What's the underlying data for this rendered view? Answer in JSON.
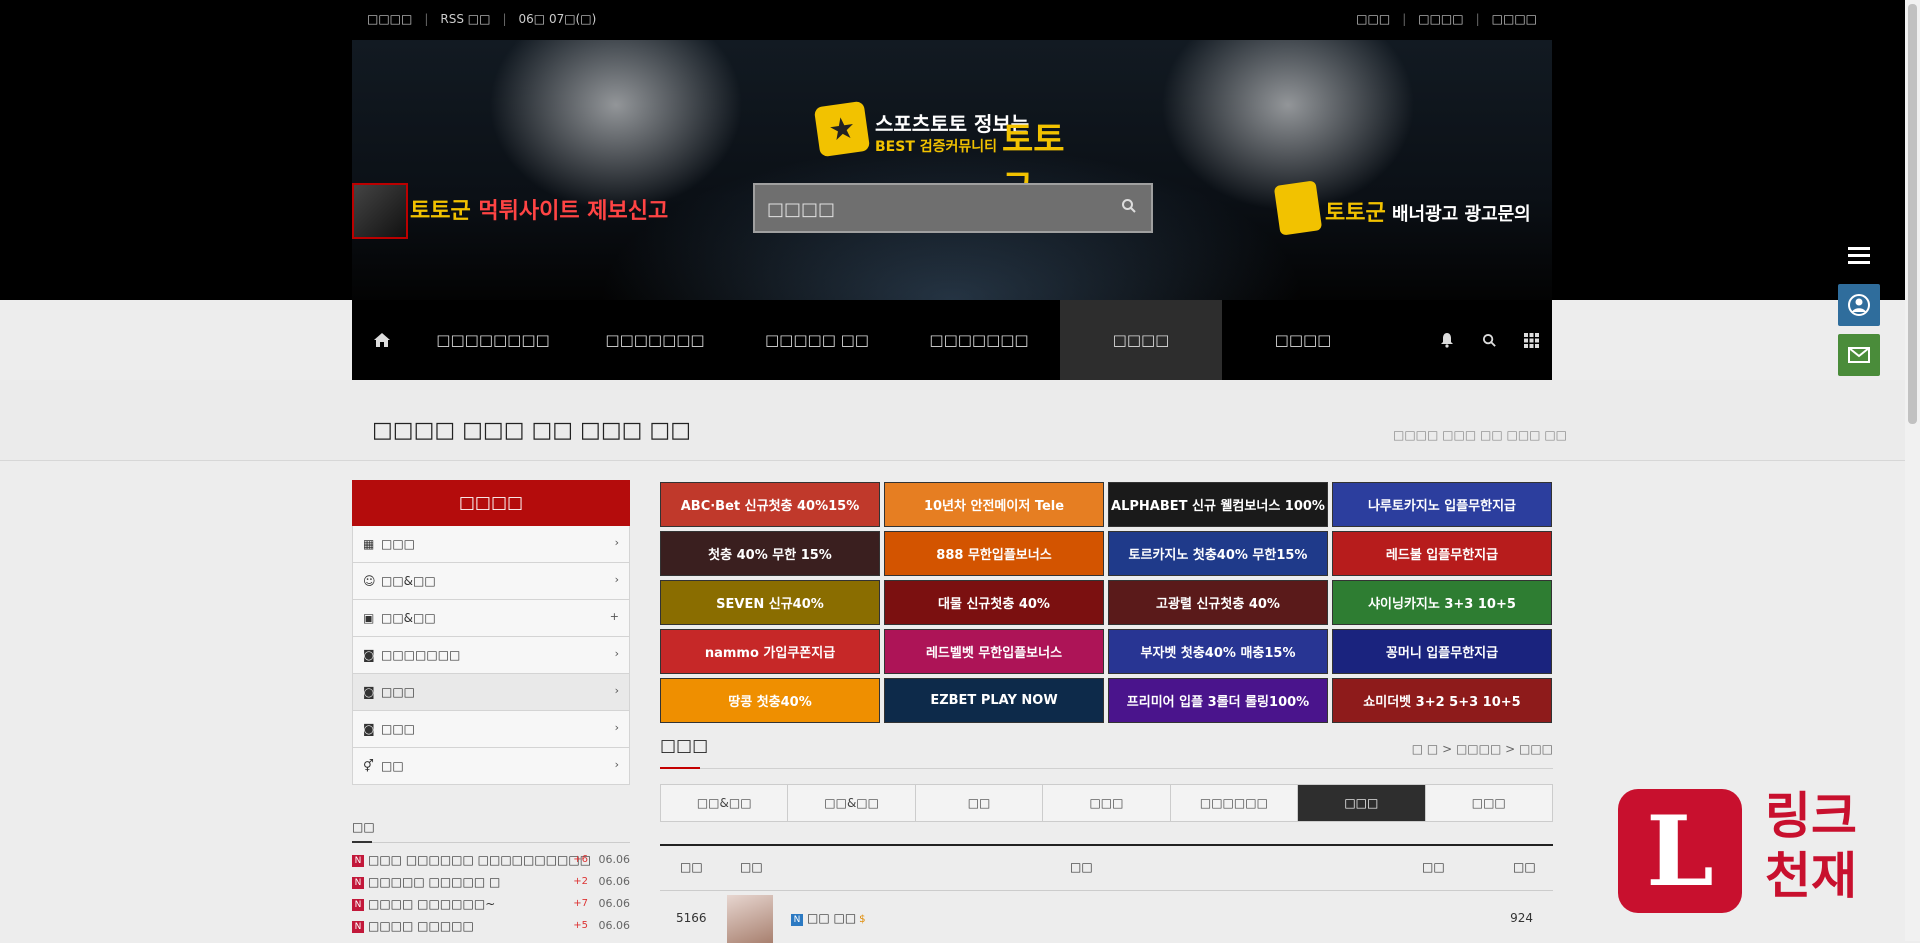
{
  "topbar": {
    "left": [
      "□□□□",
      "RSS □□",
      "06□ 07□(□)"
    ],
    "right": [
      "□□□",
      "□□□□",
      "□□□□"
    ]
  },
  "logo": {
    "line1": "스포츠토토 정보는",
    "line2": "BEST 검증커뮤니티",
    "brand": "토토군"
  },
  "search": {
    "placeholder": "□□□□"
  },
  "banner_left": {
    "text_yellow": "토토군",
    "text_red": " 먹튀사이트 제보신고"
  },
  "banner_right": {
    "text_yellow": "토토군",
    "text_white": " 배너광고 광고문의"
  },
  "nav": {
    "items": [
      "□□□□□□□□",
      "□□□□□□□",
      "□□□□□ □□",
      "□□□□□□□",
      "□□□□",
      "□□□□"
    ],
    "active_index": 4
  },
  "page": {
    "title": "□□□□ □□□ □□ □□□ □□",
    "breadcrumb": "□□□□ □□□ □□ □□□ □□"
  },
  "sidebar": {
    "head": "□□□□",
    "items": [
      {
        "icon": "calendar-icon",
        "label": "□□□",
        "arrow": "›"
      },
      {
        "icon": "smile-icon",
        "label": "□□&□□",
        "arrow": "›"
      },
      {
        "icon": "image-icon",
        "label": "□□&□□",
        "arrow": "+"
      },
      {
        "icon": "camera-icon",
        "label": "□□□□□□□",
        "arrow": "›"
      },
      {
        "icon": "camera-icon",
        "label": "□□□",
        "arrow": "›"
      },
      {
        "icon": "camera-icon",
        "label": "□□□",
        "arrow": "›"
      },
      {
        "icon": "gender-icon",
        "label": "□□",
        "arrow": "›"
      }
    ],
    "active_index": 4
  },
  "recent": {
    "title": "□□",
    "items": [
      {
        "badge": "N",
        "title": "□□□ □□□□□□ □□□□□□□□□□",
        "count": "+6",
        "date": "06.06"
      },
      {
        "badge": "N",
        "title": "□□□□□ □□□□□ □",
        "count": "+2",
        "date": "06.06"
      },
      {
        "badge": "N",
        "title": "□□□□ □□□□□□~",
        "count": "+7",
        "date": "06.06"
      },
      {
        "badge": "N",
        "title": "□□□□ □□□□□",
        "count": "+5",
        "date": "06.06"
      }
    ]
  },
  "banners": [
    {
      "text": "ABC·Bet 신규첫충 40%15%",
      "bg": "#c0392b"
    },
    {
      "text": "10년차 안전메이저 Tele",
      "bg": "#e67e22"
    },
    {
      "text": "ALPHABET 신규 웰컴보너스 100%",
      "bg": "#1a1a1a"
    },
    {
      "text": "나루토카지노 입플무한지급",
      "bg": "#2c3e9e"
    },
    {
      "text": "첫충 40% 무한 15%",
      "bg": "#3a1f1f"
    },
    {
      "text": "888 무한입플보너스",
      "bg": "#d35400"
    },
    {
      "text": "토르카지노 첫충40% 무한15%",
      "bg": "#1f3a8a"
    },
    {
      "text": "레드불 입플무한지급",
      "bg": "#b71c1c"
    },
    {
      "text": "SEVEN 신규40%",
      "bg": "#8a6d00"
    },
    {
      "text": "대물 신규첫충 40%",
      "bg": "#7b1010"
    },
    {
      "text": "고광렬 신규첫충 40%",
      "bg": "#5a1a1a"
    },
    {
      "text": "샤이닝카지노 3+3 10+5",
      "bg": "#2e7d32"
    },
    {
      "text": "nammo 가입쿠폰지급",
      "bg": "#c62828"
    },
    {
      "text": "레드벨벳 무한입플보너스",
      "bg": "#ad1457"
    },
    {
      "text": "부자벳 첫충40% 매충15%",
      "bg": "#283593"
    },
    {
      "text": "꽁머니 입플무한지급",
      "bg": "#1a237e"
    },
    {
      "text": "땅콩 첫충40%",
      "bg": "#ef8f00"
    },
    {
      "text": "EZBET PLAY NOW",
      "bg": "#0d2a4a"
    },
    {
      "text": "프리미어 입플 3롤더 롤링100%",
      "bg": "#4a148c"
    },
    {
      "text": "쇼미더벳 3+2 5+3 10+5",
      "bg": "#8e1b1b"
    }
  ],
  "board": {
    "title": "□□□",
    "crumb": "□ □ > □□□□ > □□□"
  },
  "tabs": {
    "items": [
      "□□&□□",
      "□□&□□",
      "□□",
      "□□□",
      "□□□□□□",
      "□□□",
      "□□□"
    ],
    "active_index": 5
  },
  "table": {
    "headers": {
      "num": "□□",
      "img": "□□",
      "title": "□□",
      "author": "□□",
      "views": "□□"
    },
    "rows": [
      {
        "num": "5166",
        "badge": "N",
        "title": "□□ □□",
        "coin": "$",
        "views": "924"
      }
    ]
  },
  "watermark": {
    "letter": "L",
    "line1": "링크",
    "line2": "천재"
  }
}
